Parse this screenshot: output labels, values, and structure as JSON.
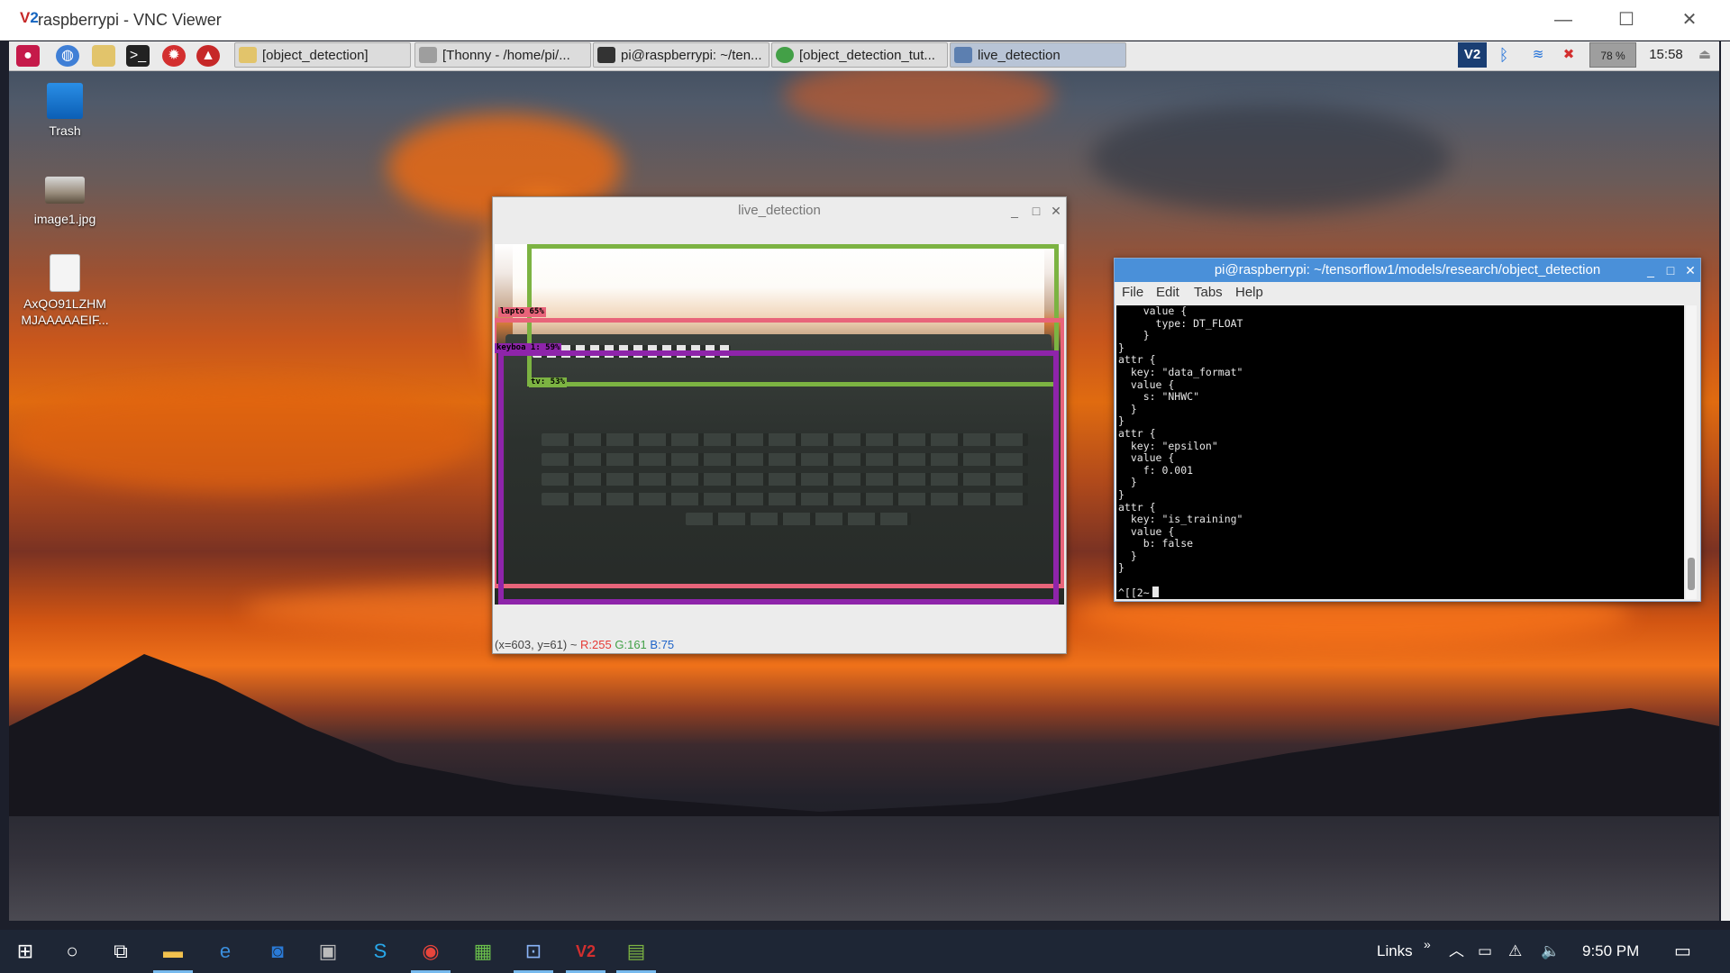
{
  "vnc": {
    "title": "raspberrypi - VNC Viewer",
    "minimize": "—",
    "maximize": "☐",
    "close": "✕"
  },
  "pi_panel": {
    "tasks": [
      {
        "label": "[object_detection]"
      },
      {
        "label": "[Thonny  -  /home/pi/..."
      },
      {
        "label": "pi@raspberrypi: ~/ten..."
      },
      {
        "label": "[object_detection_tut..."
      },
      {
        "label": "live_detection"
      }
    ],
    "battery": "78 %",
    "clock": "15:58"
  },
  "desktop": {
    "icons": [
      {
        "label": "Trash"
      },
      {
        "label": "image1.jpg"
      },
      {
        "label": "AxQO91LZHM MJAAAAAEIF..."
      }
    ]
  },
  "live_window": {
    "title": "live_detection",
    "detections": [
      {
        "label": "lapto   65%",
        "color": "#e8647a"
      },
      {
        "label": "keyboa  1: 59%",
        "color": "#8e24aa"
      },
      {
        "label": "tv: 53%",
        "color": "#7cb342"
      }
    ],
    "status_prefix": "(x=603, y=61) ~ ",
    "status_r": "R:255",
    "status_g": "G:161",
    "status_b": "B:75"
  },
  "terminal": {
    "title": "pi@raspberrypi: ~/tensorflow1/models/research/object_detection",
    "menu": [
      "File",
      "Edit",
      "Tabs",
      "Help"
    ],
    "text": "    value {\n      type: DT_FLOAT\n    }\n}\nattr {\n  key: \"data_format\"\n  value {\n    s: \"NHWC\"\n  }\n}\nattr {\n  key: \"epsilon\"\n  value {\n    f: 0.001\n  }\n}\nattr {\n  key: \"is_training\"\n  value {\n    b: false\n  }\n}\n\n^[[2~"
  },
  "win_taskbar": {
    "links_label": "Links",
    "clock": "9:50 PM"
  }
}
